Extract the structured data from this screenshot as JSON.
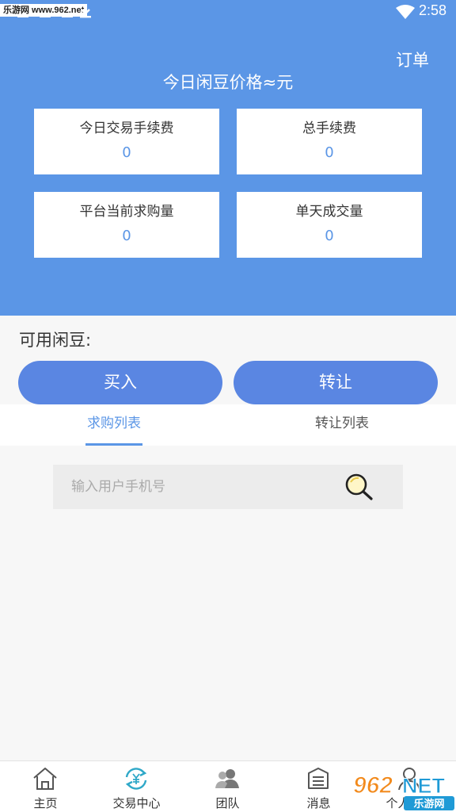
{
  "status_bar": {
    "watermark": "乐游网 www.962.net",
    "time": "2:58"
  },
  "header": {
    "orders_link": "订单",
    "price_title": "今日闲豆价格≈元"
  },
  "stats": [
    {
      "label": "今日交易手续费",
      "value": "0"
    },
    {
      "label": "总手续费",
      "value": "0"
    },
    {
      "label": "平台当前求购量",
      "value": "0"
    },
    {
      "label": "单天成交量",
      "value": "0"
    }
  ],
  "balance": {
    "label": "可用闲豆:"
  },
  "actions": {
    "buy_label": "买入",
    "transfer_label": "转让"
  },
  "tabs": [
    {
      "label": "求购列表",
      "active": true
    },
    {
      "label": "转让列表",
      "active": false
    }
  ],
  "search": {
    "placeholder": "输入用户手机号",
    "value": ""
  },
  "bottom_nav": [
    {
      "label": "主页",
      "icon": "home-icon"
    },
    {
      "label": "交易中心",
      "icon": "exchange-icon",
      "active": true
    },
    {
      "label": "团队",
      "icon": "team-icon"
    },
    {
      "label": "消息",
      "icon": "message-icon"
    },
    {
      "label": "个人中心",
      "icon": "profile-icon"
    }
  ],
  "logo_watermark": {
    "brand_number": "962",
    "brand_suffix": "NET",
    "brand_name": "乐游网"
  },
  "colors": {
    "primary": "#5b96e6",
    "button": "#5a86e2",
    "accent_icon": "#2fa8c8"
  }
}
